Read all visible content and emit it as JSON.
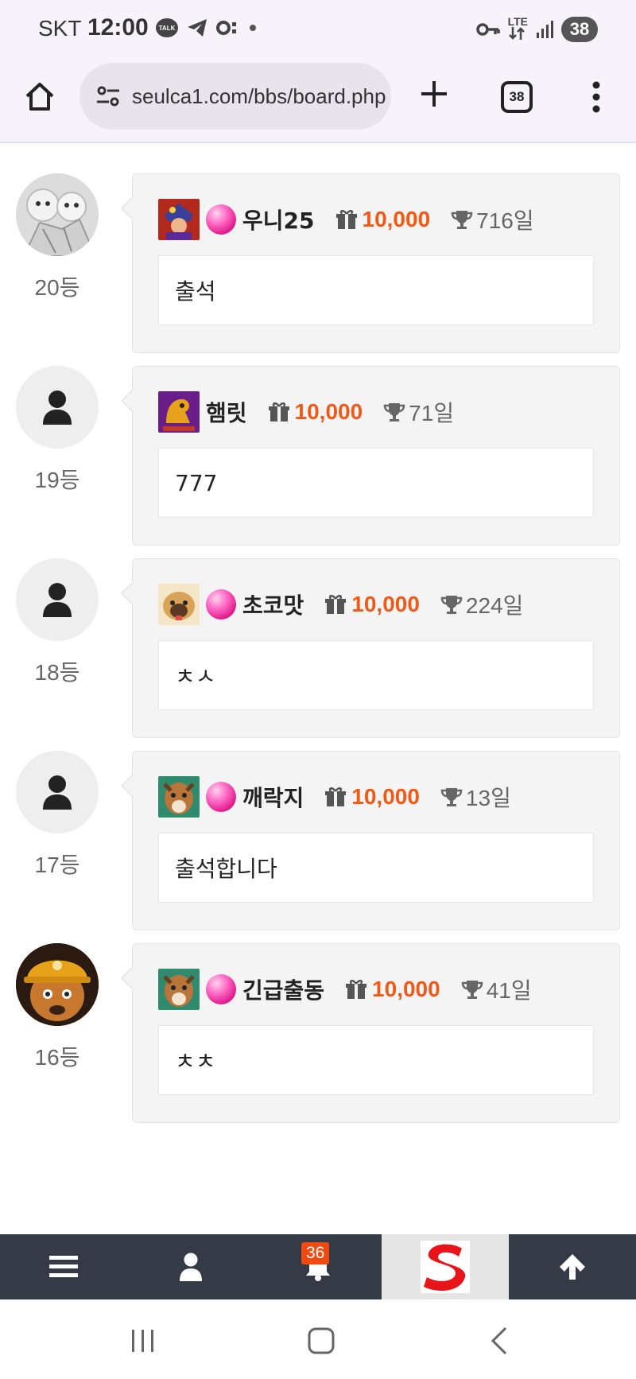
{
  "status_bar": {
    "carrier": "SKT",
    "time": "12:00",
    "talk_badge": "TALK",
    "battery": "38"
  },
  "browser": {
    "url": "seulca1.com/bbs/board.php",
    "tab_count": "38"
  },
  "entries": [
    {
      "rank": "20등",
      "nickname": "우니25",
      "points": "10,000",
      "days": "716일",
      "comment": "출석"
    },
    {
      "rank": "19등",
      "nickname": "햄릿",
      "points": "10,000",
      "days": "71일",
      "comment": "777"
    },
    {
      "rank": "18등",
      "nickname": "초코맛",
      "points": "10,000",
      "days": "224일",
      "comment": "ㅊㅅ"
    },
    {
      "rank": "17등",
      "nickname": "깨락지",
      "points": "10,000",
      "days": "13일",
      "comment": "출석합니다"
    },
    {
      "rank": "16등",
      "nickname": "긴급출동",
      "points": "10,000",
      "days": "41일",
      "comment": "ㅊㅊ"
    }
  ],
  "site_nav": {
    "notification_count": "36"
  },
  "colors": {
    "points": "#f05a16",
    "nav_bg": "#343b46",
    "badge": "#f04a10",
    "gem": "#ff4fb4"
  }
}
